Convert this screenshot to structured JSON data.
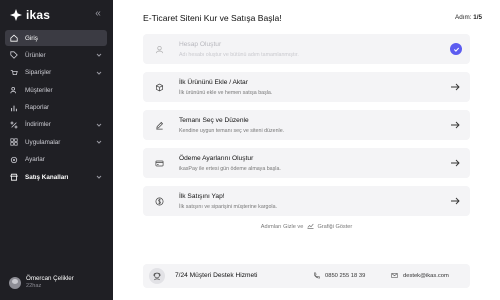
{
  "brand": {
    "name": "ikas"
  },
  "sidebar": {
    "collapse_icon": "double-chevron-left-icon",
    "items": [
      {
        "label": "Giriş",
        "icon": "home-icon",
        "active": true,
        "has_chevron": false
      },
      {
        "label": "Ürünler",
        "icon": "tag-icon",
        "active": false,
        "has_chevron": true
      },
      {
        "label": "Siparişler",
        "icon": "cart-icon",
        "active": false,
        "has_chevron": true
      },
      {
        "label": "Müşteriler",
        "icon": "users-icon",
        "active": false,
        "has_chevron": false
      },
      {
        "label": "Raporlar",
        "icon": "bar-chart-icon",
        "active": false,
        "has_chevron": false
      },
      {
        "label": "İndirimler",
        "icon": "percent-icon",
        "active": false,
        "has_chevron": true
      },
      {
        "label": "Uygulamalar",
        "icon": "grid-icon",
        "active": false,
        "has_chevron": true
      },
      {
        "label": "Ayarlar",
        "icon": "gear-icon",
        "active": false,
        "has_chevron": false
      },
      {
        "label": "Satış Kanalları",
        "icon": "store-icon",
        "active": false,
        "has_chevron": true,
        "bold": true
      }
    ],
    "user": {
      "name": "Ömercan Çelikler",
      "sub": "22haz"
    }
  },
  "main": {
    "title": "E-Ticaret Siteni Kur ve Satışa Başla!",
    "step_label": "Adım:",
    "step_value": "1/5",
    "cards": [
      {
        "title": "Hesap Oluştur",
        "desc": "Adı hesabı oluştur ve bütünü adım tamamlanmıştır.",
        "icon": "user-icon",
        "done": true
      },
      {
        "title": "İlk Ürününü Ekle / Aktar",
        "desc": "İlk ürününü ekle ve hemen satışa başla.",
        "icon": "box-icon",
        "done": false
      },
      {
        "title": "Temanı Seç ve Düzenle",
        "desc": "Kendine uygun temanı seç ve siteni düzenle.",
        "icon": "pencil-icon",
        "done": false
      },
      {
        "title": "Ödeme Ayarlarını Oluştur",
        "desc": "ikasPay ile ertesi gün ödeme almaya başla.",
        "icon": "credit-card-icon",
        "done": false
      },
      {
        "title": "İlk Satışını Yap!",
        "desc": "İlk satışını ve siparişini müşterine kargola.",
        "icon": "dollar-icon",
        "done": false
      }
    ],
    "hide_steps_prefix": "Adımları Gizle ve",
    "hide_steps_suffix": "Grafiği Göster",
    "support": {
      "title": "7/24 Müşteri Destek Hizmeti",
      "phone": "0850 255 18 39",
      "email": "destek@ikas.com"
    }
  },
  "colors": {
    "sidebar_bg": "#1f1f24",
    "accent": "#5c5cf0",
    "card_bg": "#f4f4f6"
  }
}
